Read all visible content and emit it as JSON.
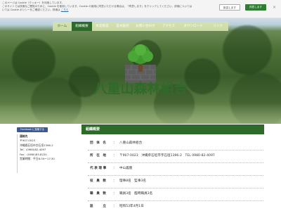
{
  "cookie": {
    "text_line1": "このページは Cookie（クッキー）を利用しています。",
    "text_line2": "このサイトでは快適なご閲覧のために、Cookie を使用しています。Cookie の使用に同意いただける場合は、「同意します」をクリックしてください。詳細については",
    "text_line3": "いては Cookie ポリシーをご確認ください。詳細は",
    "link_label": "こちら",
    "decline_label": "拒否します",
    "accept_label": "同意します",
    "close_label": "×"
  },
  "nav": {
    "items": [
      {
        "label": "ホーム"
      },
      {
        "label": "組織概要"
      },
      {
        "label": "木炭製造"
      },
      {
        "label": "苗木販売"
      },
      {
        "label": "お問い合わせ"
      },
      {
        "label": "アクセス"
      },
      {
        "label": "ダウンロード"
      },
      {
        "label": "リンク"
      }
    ]
  },
  "site": {
    "title": "八重山森林組合"
  },
  "sidebar": {
    "facebook_label": "Facebook に投稿する",
    "contact": {
      "heading": "連絡先",
      "zip": "〒907-0023",
      "address": "沖縄県石垣市字石垣1396-2",
      "tel": "Tel：(0980)82-4097",
      "fax": "Fax：(0980)83-8220",
      "hours": "営業時間：平日8:30〜17:30"
    }
  },
  "main": {
    "section_title": "組織概要",
    "rows": [
      {
        "label": "団　体　名",
        "value": "八重山森林組合"
      },
      {
        "label": "所　在　地",
        "value": "〒907-0023　沖縄県石垣市字石垣1396-2　TEL 0980-82-4097"
      },
      {
        "label": "代 表 理 事",
        "value": "中山義隆"
      },
      {
        "label": "役　員　数",
        "value": "理事8名　監事3名"
      },
      {
        "label": "職　員　数",
        "value": "職員3名　臨時職員3名"
      },
      {
        "label": "設　　　立",
        "value": "昭和53年4月1日"
      }
    ],
    "separator": "："
  },
  "colors": {
    "primary_green": "#2e6b2a",
    "facebook_blue": "#3b5998",
    "nav_bg": "#d2e1aa"
  }
}
